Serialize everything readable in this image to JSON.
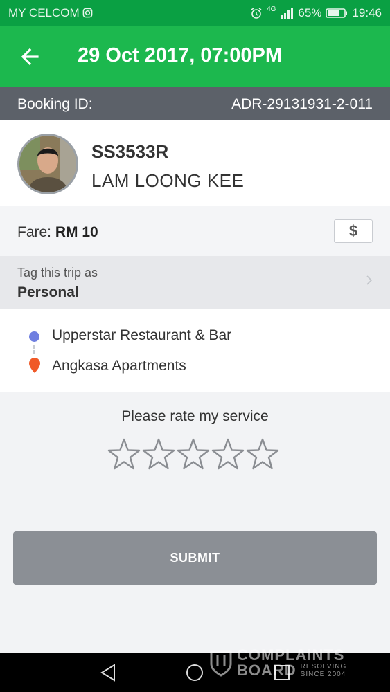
{
  "status_bar": {
    "carrier": "MY CELCOM",
    "network": "4G",
    "battery": "65%",
    "time": "19:46"
  },
  "app_bar": {
    "title": "29 Oct 2017, 07:00PM"
  },
  "booking": {
    "label": "Booking ID:",
    "id": "ADR-29131931-2-011"
  },
  "driver": {
    "plate": "SS3533R",
    "name": "LAM LOONG KEE"
  },
  "fare": {
    "label": "Fare:",
    "amount": "RM 10",
    "button_symbol": "$"
  },
  "tag": {
    "hint": "Tag this trip as",
    "value": "Personal"
  },
  "route": {
    "pickup": "Upperstar Restaurant & Bar",
    "dropoff": "Angkasa Apartments"
  },
  "rating": {
    "prompt": "Please rate my service",
    "max_stars": 5,
    "selected": 0
  },
  "submit_label": "SUBMIT",
  "watermark": {
    "brand_top": "COMPLAINTS",
    "brand_bottom": "BOARD",
    "tag_top": "RESOLVING",
    "tag_bottom": "SINCE 2004"
  },
  "colors": {
    "app_bar": "#1cb84e",
    "status_bar": "#0aa043",
    "booking_bar": "#5c6169",
    "pickup_dot": "#6f7fe0",
    "dropoff_pin": "#f05a28",
    "submit": "#8b8f95"
  },
  "icons": {
    "back": "arrow-left-icon",
    "instagram": "instagram-icon",
    "alarm": "alarm-icon",
    "signal": "signal-icon",
    "battery": "battery-icon",
    "star": "star-outline-icon",
    "pin": "map-pin-icon"
  }
}
